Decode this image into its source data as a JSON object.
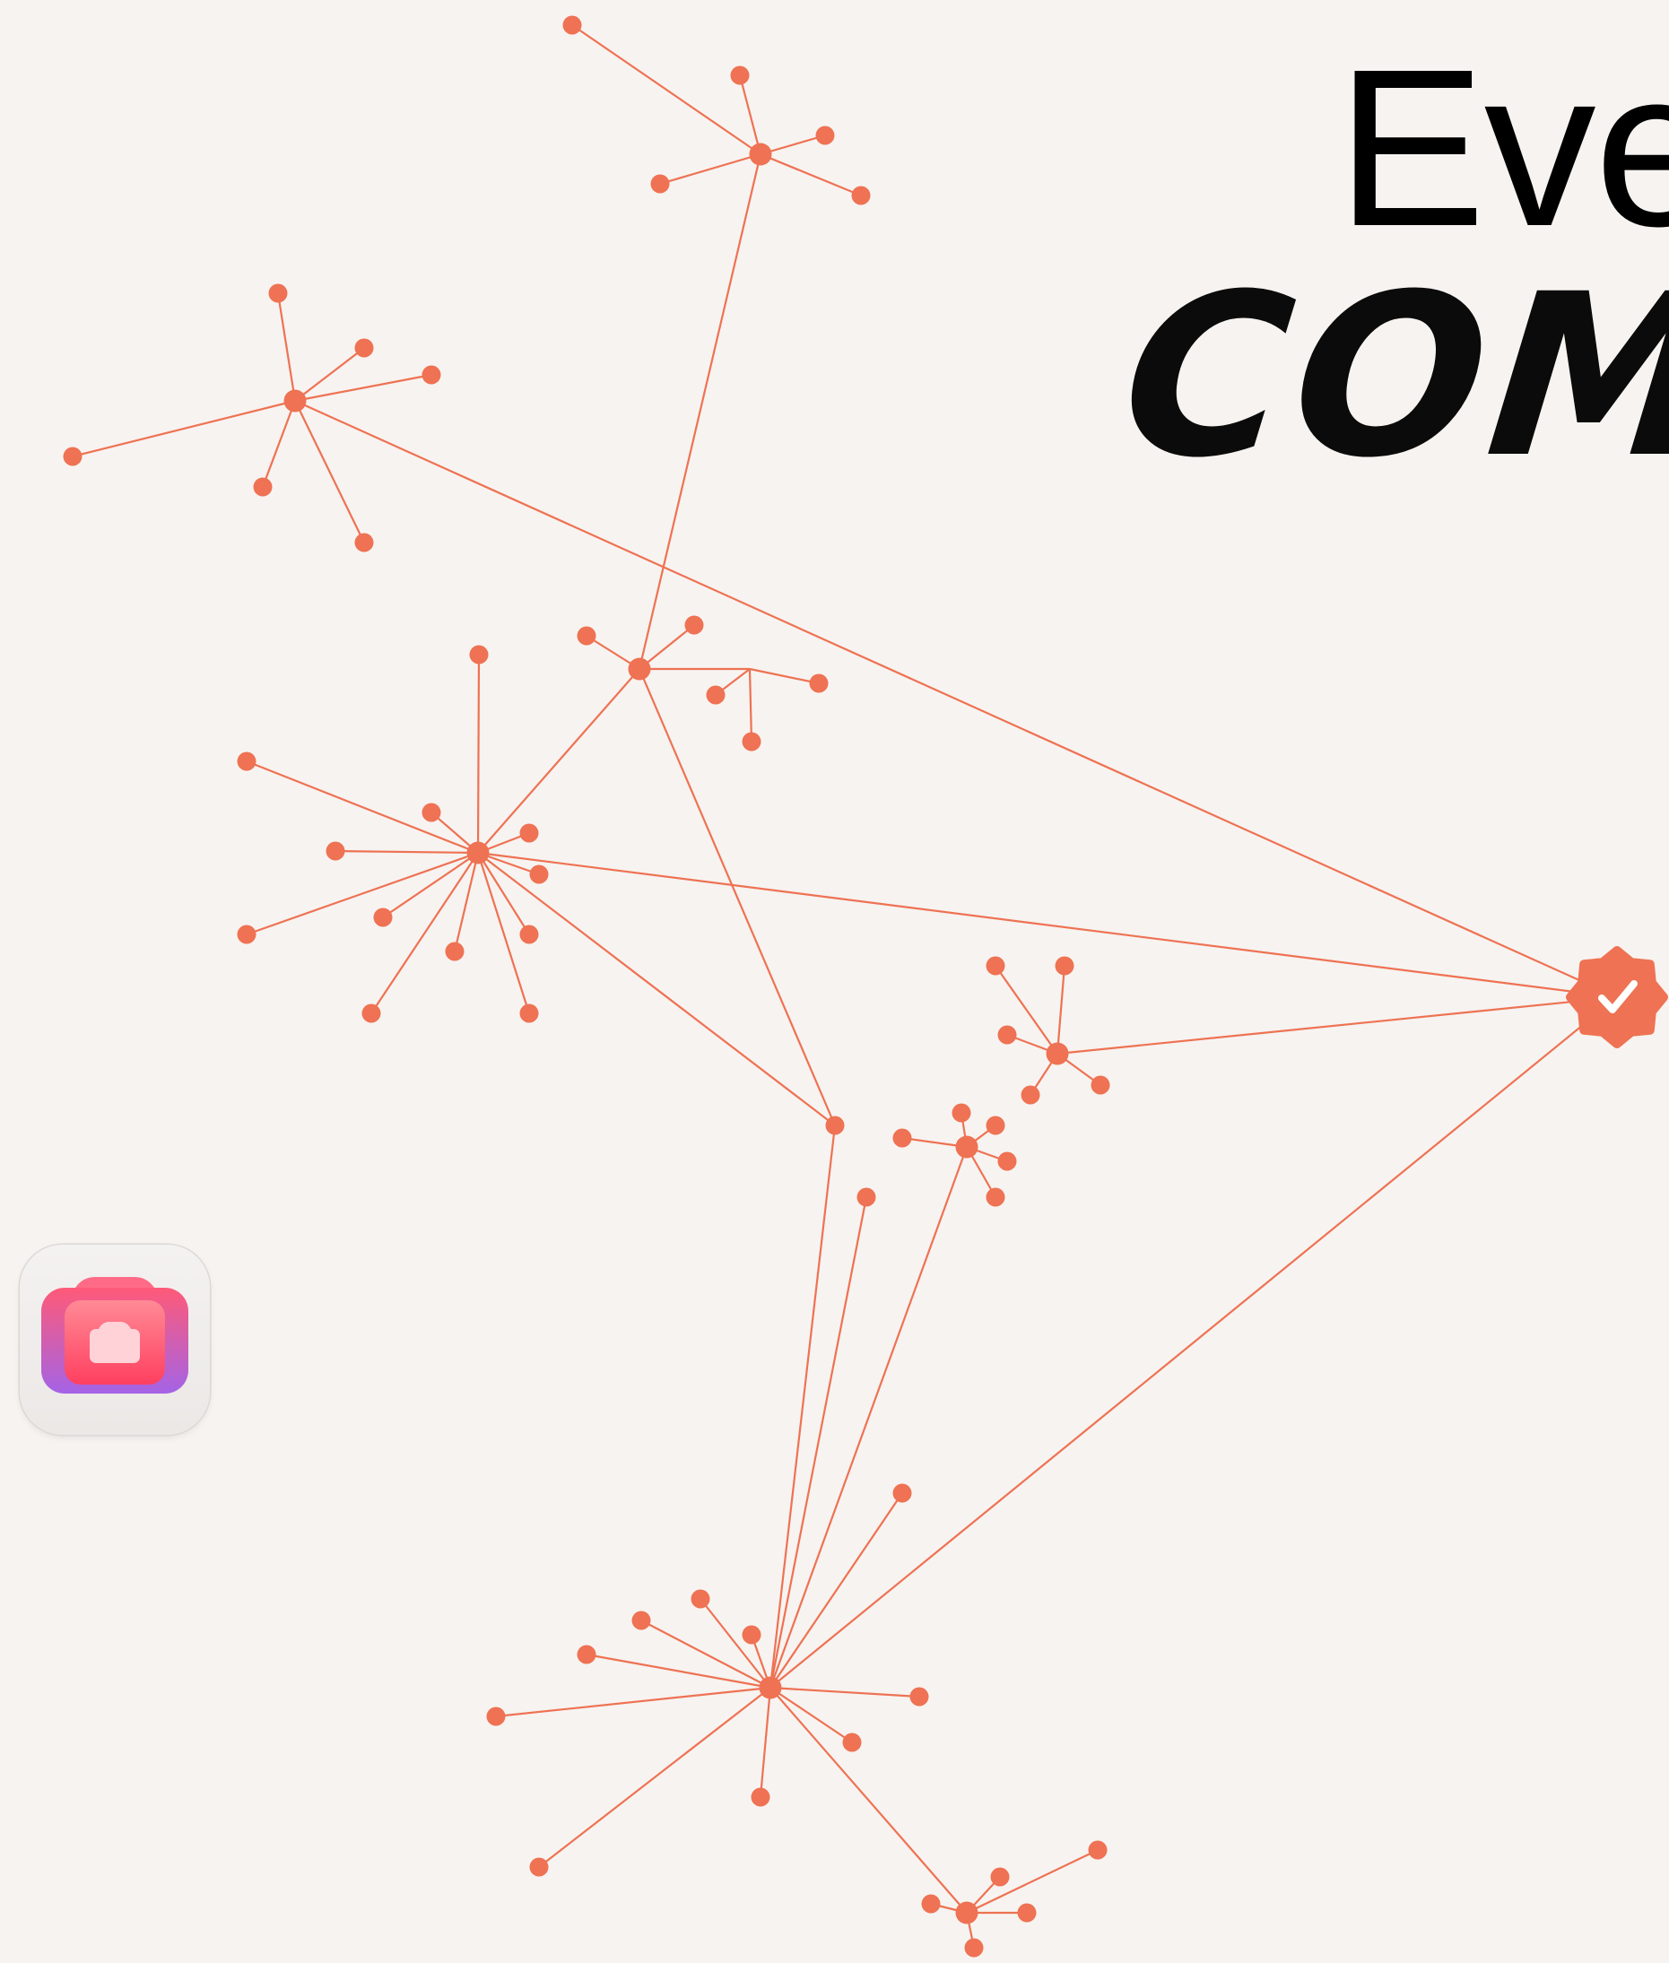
{
  "headline": "Eve",
  "subheadline": "COMP",
  "colors": {
    "background": "#f7f3f0",
    "network": "#ee7253",
    "text": "#000000"
  },
  "icons": {
    "app": "camera-app-icon",
    "verified": "verified-badge-icon"
  }
}
